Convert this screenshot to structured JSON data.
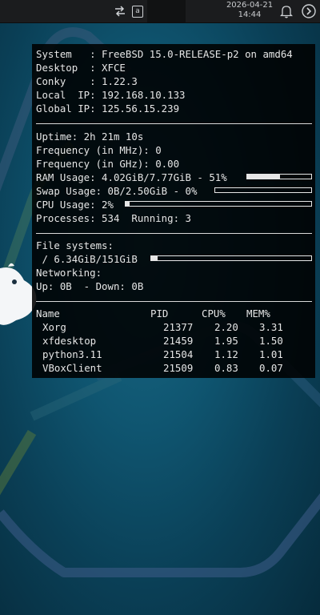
{
  "panel": {
    "date": "2026-04-21",
    "time": "14:44",
    "icons": [
      "network-sync-icon",
      "keyboard-layout-icon",
      "notification-bell-icon",
      "session-next-icon"
    ],
    "keyboard_layout": "a"
  },
  "conky": {
    "system": "System   : FreeBSD 15.0-RELEASE-p2 on amd64",
    "desktop": "Desktop  : XFCE",
    "conky": "Conky    : 1.22.3",
    "local_ip": "Local  IP: 192.168.10.133",
    "global_ip": "Global IP: 125.56.15.239",
    "uptime": "Uptime: 2h 21m 10s",
    "freq_mhz": "Frequency (in MHz): 0",
    "freq_ghz": "Frequency (in GHz): 0.00",
    "ram": {
      "text": "RAM Usage: 4.02GiB/7.77GiB - 51%",
      "percent": 51
    },
    "swap": {
      "text": "Swap Usage: 0B/2.50GiB - 0%",
      "percent": 0
    },
    "cpu": {
      "text": "CPU Usage: 2%",
      "percent": 2
    },
    "processes": "Processes: 534  Running: 3",
    "fs_header": "File systems:",
    "fs_root": {
      "text": " / 6.34GiB/151GiB",
      "percent": 4
    },
    "net_header": "Networking:",
    "net_rates": "Up: 0B  - Down: 0B",
    "table": {
      "headers": {
        "name": "Name",
        "pid": "PID",
        "cpu": "CPU%",
        "mem": "MEM%"
      },
      "rows": [
        {
          "name": "Xorg",
          "pid": "21377",
          "cpu": "2.20",
          "mem": "3.31"
        },
        {
          "name": "xfdesktop",
          "pid": "21459",
          "cpu": "1.95",
          "mem": "1.50"
        },
        {
          "name": "python3.11",
          "pid": "21504",
          "cpu": "1.12",
          "mem": "1.01"
        },
        {
          "name": "VBoxClient",
          "pid": "21509",
          "cpu": "0.83",
          "mem": "0.07"
        }
      ]
    }
  }
}
